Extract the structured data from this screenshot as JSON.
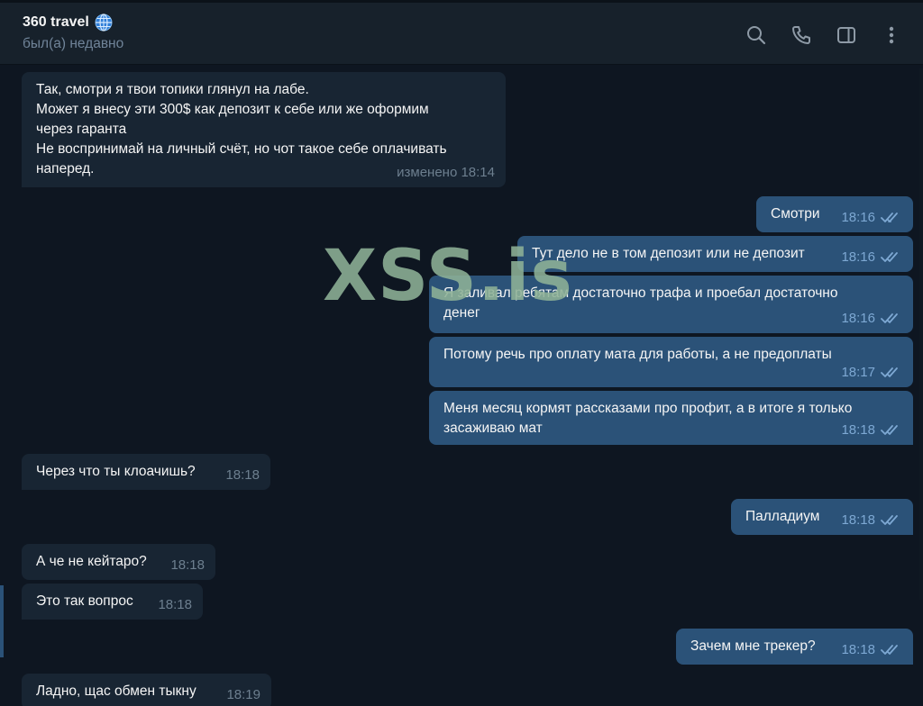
{
  "header": {
    "title": "360 travel",
    "status": "был(а) недавно",
    "icons": [
      "search-icon",
      "phone-icon",
      "sidebar-toggle-icon",
      "more-vertical-icon"
    ]
  },
  "watermark": "XSS.is",
  "messages": [
    {
      "dir": "in",
      "text": "Так, смотри я твои топики глянул на лабе.\nМожет я внесу эти 300$ как депозит к себе или же оформим\nчерез гаранта\nНе воспринимай на личный счёт, но чот такое себе оплачивать\nнаперед.",
      "meta": "изменено 18:14"
    },
    {
      "dir": "out",
      "text": "Смотри",
      "meta": "18:16"
    },
    {
      "dir": "out",
      "text": "Тут дело не в том депозит или не депозит",
      "meta": "18:16"
    },
    {
      "dir": "out",
      "text": "Я заливал ребятам достаточно трафа и проебал достаточно\nденег",
      "meta": "18:16"
    },
    {
      "dir": "out",
      "text": "Потому речь про оплату мата для работы, а не предоплаты",
      "meta": "18:17"
    },
    {
      "dir": "out",
      "text": "Меня месяц кормят рассказами про профит, а в итоге я только\nзасаживаю мат",
      "meta": "18:18"
    },
    {
      "dir": "in",
      "text": "Через что ты клоачишь?",
      "meta": "18:18"
    },
    {
      "dir": "out",
      "text": "Палладиум",
      "meta": "18:18"
    },
    {
      "dir": "in",
      "text": "А че не кейтаро?",
      "meta": "18:18"
    },
    {
      "dir": "in",
      "text": "Это так вопрос",
      "meta": "18:18"
    },
    {
      "dir": "out",
      "text": "Зачем мне трекер?",
      "meta": "18:18"
    },
    {
      "dir": "in",
      "text": "Ладно, щас обмен тыкну",
      "meta": "18:19"
    }
  ],
  "colors": {
    "background": "#0e1621",
    "header": "#17212b",
    "incoming_bubble": "#182533",
    "outgoing_bubble": "#2b5278",
    "read_check": "#7da8d3"
  }
}
